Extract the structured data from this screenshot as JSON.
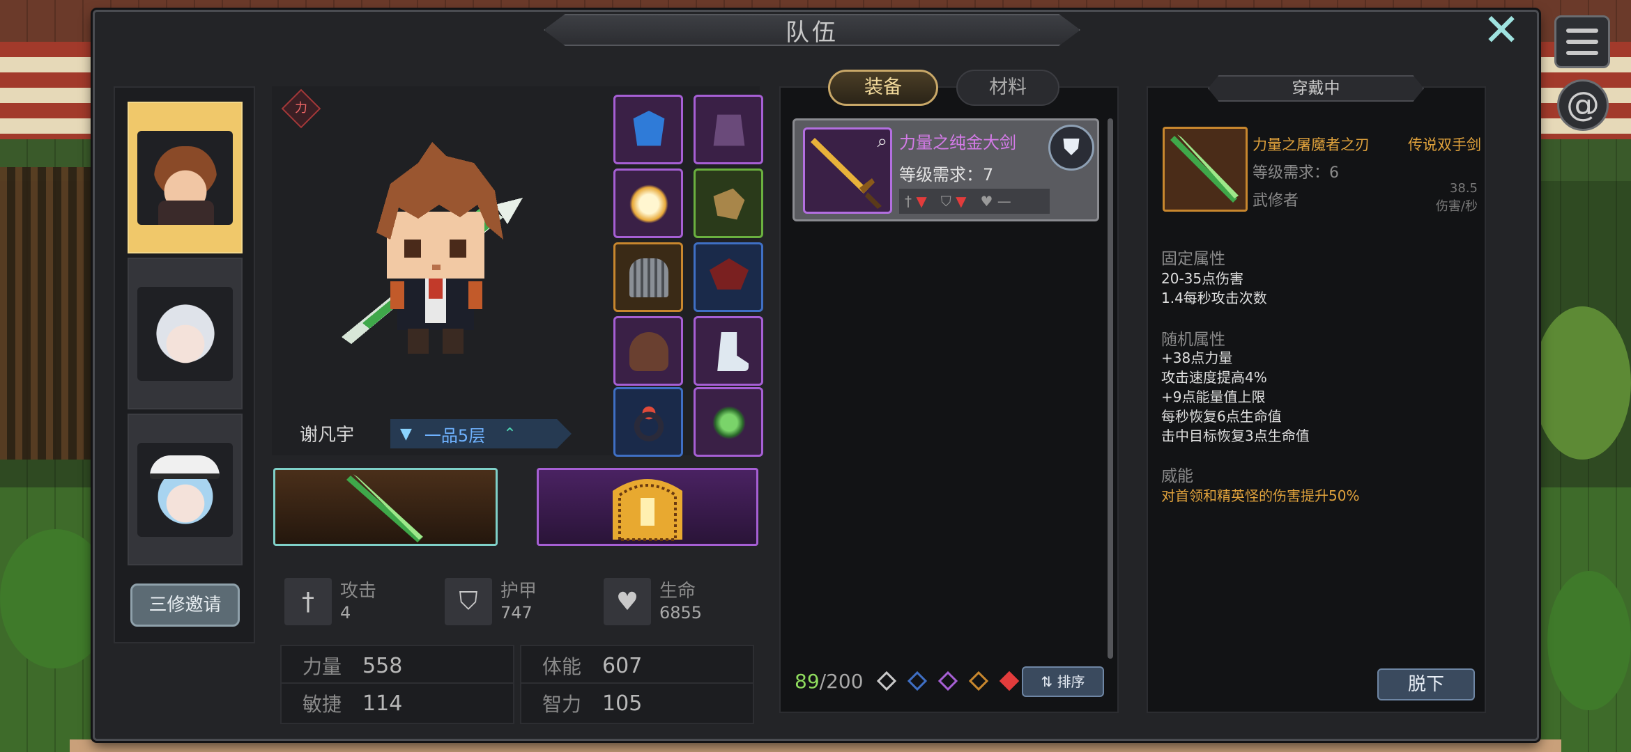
{
  "title": "队伍",
  "roster": {
    "invite_label": "三修邀请"
  },
  "hero": {
    "name": "谢凡宇",
    "realm": "一品5层",
    "might_badge": "力"
  },
  "stats": {
    "attack_label": "攻击",
    "attack_value": "4",
    "armor_label": "护甲",
    "armor_value": "747",
    "hp_label": "生命",
    "hp_value": "6855"
  },
  "attributes": [
    {
      "label": "力量",
      "value": "558"
    },
    {
      "label": "体能",
      "value": "607"
    },
    {
      "label": "敏捷",
      "value": "114"
    },
    {
      "label": "智力",
      "value": "105"
    }
  ],
  "inventory": {
    "tabs": [
      {
        "label": "装备"
      },
      {
        "label": "材料"
      }
    ],
    "item": {
      "name": "力量之纯金大剑",
      "requirement": "等级需求：7"
    },
    "capacity_current": "89",
    "capacity_total": "/200",
    "sort_label": "排序"
  },
  "detail": {
    "header": "穿戴中",
    "name": "力量之屠魔者之刃",
    "type": "传说双手剑",
    "requirement": "等级需求：6",
    "class": "武修者",
    "dps_value": "38.5",
    "dps_unit": "伤害/秒",
    "fixed_title": "固定属性",
    "fixed": [
      "20-35点伤害",
      "1.4每秒攻击次数"
    ],
    "random_title": "随机属性",
    "random": [
      "+38点力量",
      "攻击速度提高4%",
      "+9点能量值上限",
      "每秒恢复6点生命值",
      "击中目标恢复3点生命值"
    ],
    "power_title": "威能",
    "power": "对首领和精英怪的伤害提升50%",
    "unequip_label": "脱下"
  },
  "colors": {
    "legendary": "#e0a23c",
    "epic": "#d47be8",
    "capacity_green": "#8fdc5e",
    "panel_bg": "#232427"
  },
  "icons": {
    "close": "close-icon",
    "menu": "menu-icon",
    "swirl": "swirl-icon"
  }
}
